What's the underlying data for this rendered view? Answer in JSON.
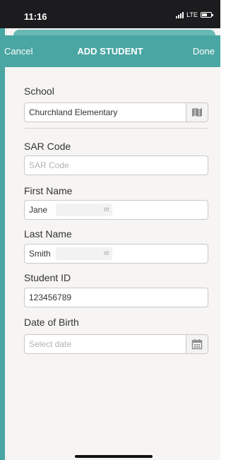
{
  "status_bar": {
    "time": "11:16",
    "network": "LTE"
  },
  "nav": {
    "cancel_label": "Cancel",
    "title": "ADD STUDENT",
    "done_label": "Done"
  },
  "form": {
    "school": {
      "label": "School",
      "value": "Churchland Elementary",
      "icon": "map-icon"
    },
    "sar_code": {
      "label": "SAR Code",
      "placeholder": "SAR Code"
    },
    "first_name": {
      "label": "First Name",
      "value": "Jane",
      "obscured_tail": "ıe"
    },
    "last_name": {
      "label": "Last Name",
      "value": "Smith",
      "obscured_tail": "ıe"
    },
    "student_id": {
      "label": "Student ID",
      "value": "123456789"
    },
    "date_of_birth": {
      "label": "Date of Birth",
      "placeholder": "Select date",
      "icon": "calendar-icon"
    }
  },
  "colors": {
    "accent": "#4aa6a3",
    "status_bar": "#1c1c1e",
    "background": "#f6f5f3"
  }
}
